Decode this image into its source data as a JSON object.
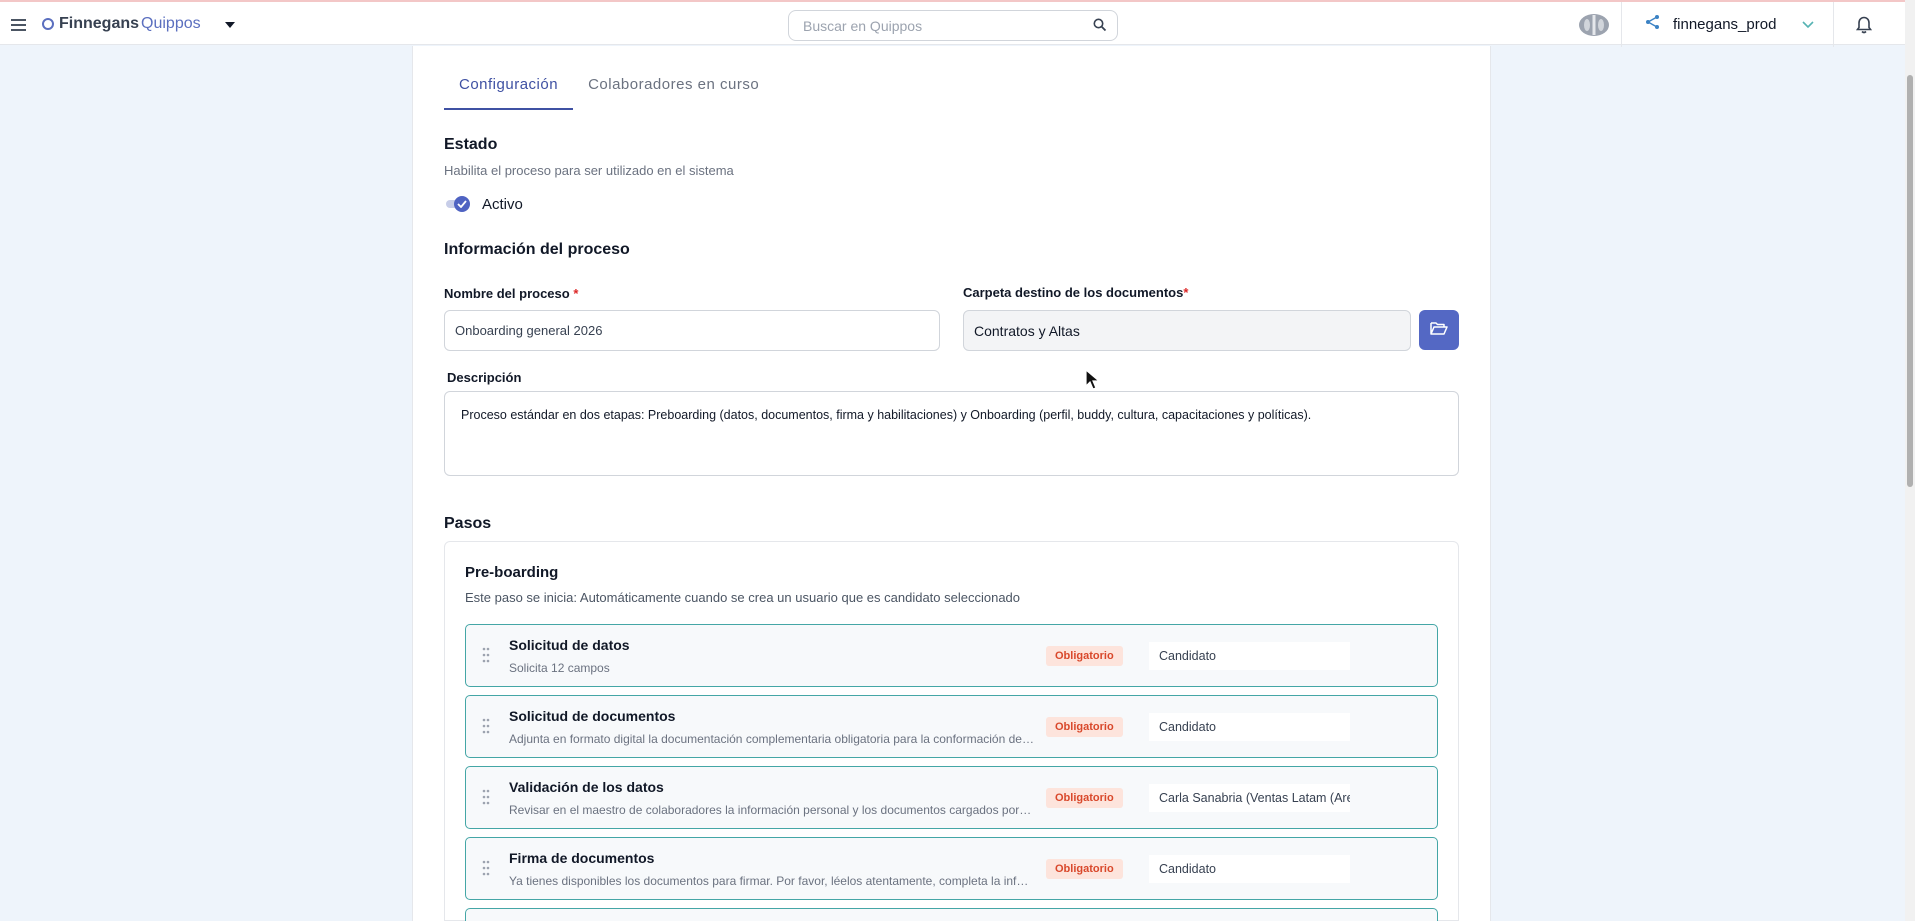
{
  "topbar": {
    "logo_part1": "Finnegans",
    "logo_part2": "Quippos",
    "search_placeholder": "Buscar en Quippos",
    "environment": "finnegans_prod"
  },
  "tabs": [
    {
      "label": "Configuración",
      "active": true
    },
    {
      "label": "Colaboradores en curso",
      "active": false
    }
  ],
  "estado": {
    "title": "Estado",
    "subtitle": "Habilita el proceso para ser utilizado en el sistema",
    "toggle_label": "Activo",
    "toggle_on": true
  },
  "info": {
    "title": "Información del proceso",
    "name_label": "Nombre del proceso",
    "name_value": "Onboarding general 2026",
    "folder_label": "Carpeta destino de los documentos",
    "folder_value": "Contratos y Altas",
    "required_mark": "*",
    "desc_label": "Descripción",
    "desc_value": "Proceso estándar en dos etapas: Preboarding (datos, documentos, firma y habilitaciones) y Onboarding (perfil, buddy, cultura, capacitaciones y políticas)."
  },
  "steps_section": {
    "title": "Pasos",
    "stage_title": "Pre-boarding",
    "stage_subtitle": "Este paso se inicia: Automáticamente cuando se crea un usuario que es candidato seleccionado",
    "steps": [
      {
        "title": "Solicitud de datos",
        "desc": "Solicita 12 campos",
        "badge": "Obligatorio",
        "assignee": "Candidato"
      },
      {
        "title": "Solicitud de documentos",
        "desc": "Adjunta en formato digital la documentación complementaria obligatoria para la conformación de tu legajo",
        "badge": "Obligatorio",
        "assignee": "Candidato"
      },
      {
        "title": "Validación de los datos",
        "desc": "Revisar en el maestro de colaboradores la información personal y los documentos cargados por el candidato",
        "badge": "Obligatorio",
        "assignee": "Carla Sanabria (Ventas Latam (Area"
      },
      {
        "title": "Firma de documentos",
        "desc": "Ya tienes disponibles los documentos para firmar. Por favor, léelos atentamente, completa la información",
        "badge": "Obligatorio",
        "assignee": "Candidato"
      }
    ]
  },
  "colors": {
    "primary": "#3f51a3",
    "button": "#5468c4",
    "step_border": "#44a6a6",
    "badge_bg": "#fde4dc",
    "badge_text": "#d9482b",
    "page_bg": "#eef4fb"
  },
  "icons": [
    "menu-icon",
    "caret-down-icon",
    "search-icon",
    "brain-icon",
    "share-icon",
    "chevron-down-icon",
    "bell-icon",
    "check-icon",
    "folder-open-icon",
    "drag-handle-icon",
    "cursor-icon"
  ]
}
